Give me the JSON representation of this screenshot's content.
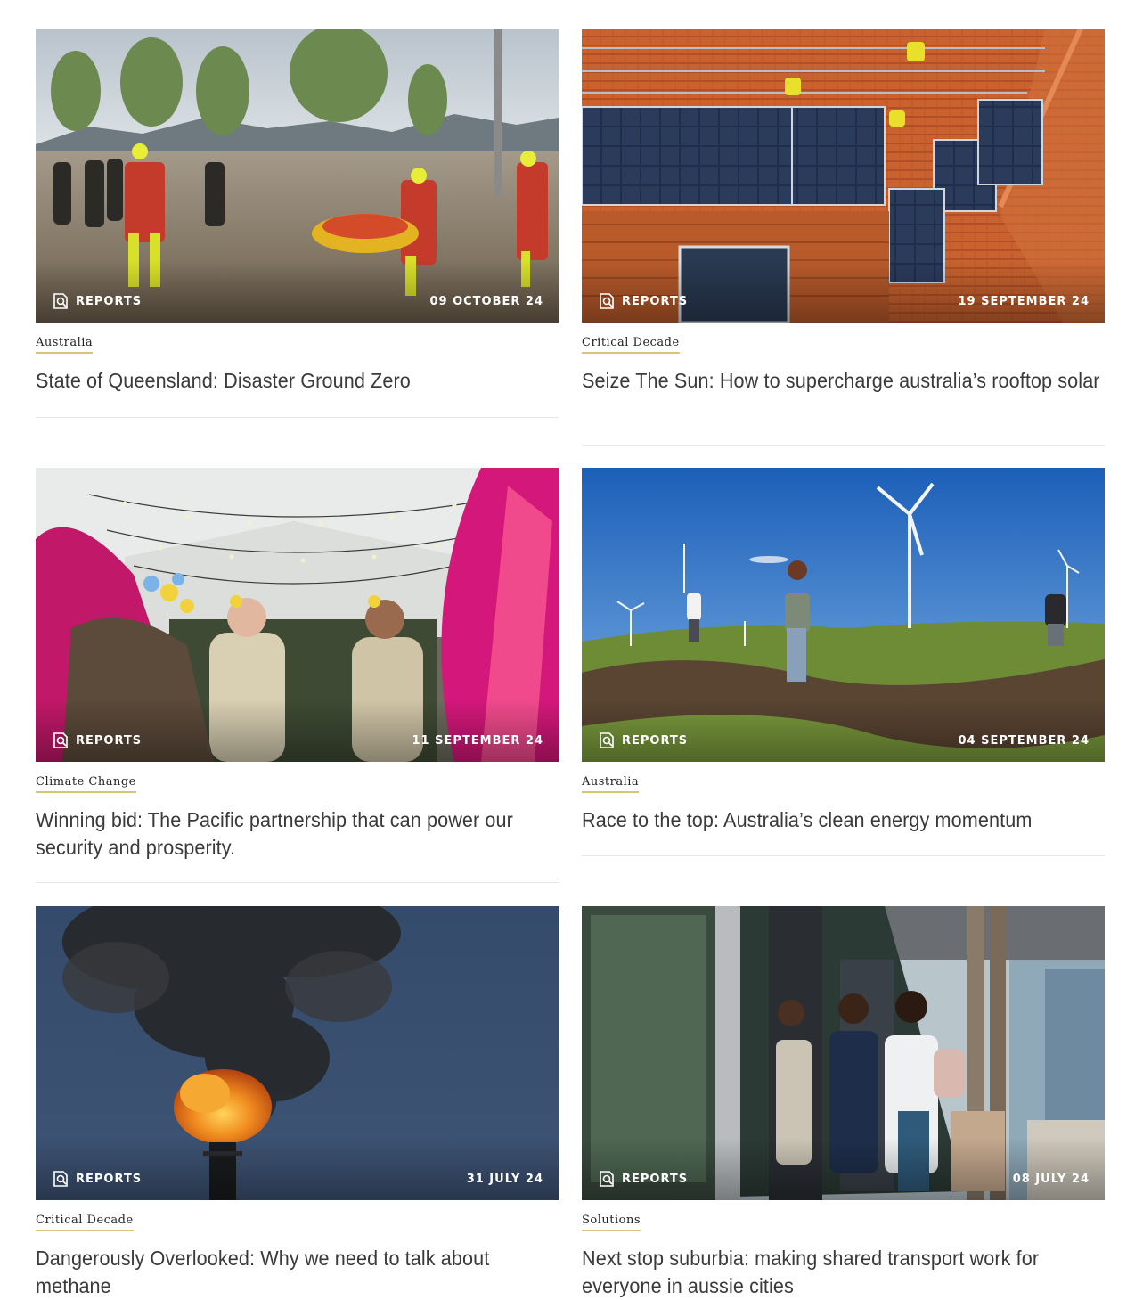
{
  "cards": [
    {
      "type_label": "REPORTS",
      "date": "09 OCTOBER 24",
      "category": "Australia",
      "title": "State of Queensland: Disaster Ground Zero"
    },
    {
      "type_label": "REPORTS",
      "date": "19 SEPTEMBER 24",
      "category": "Critical Decade",
      "title": "Seize The Sun: How to supercharge australia’s rooftop solar"
    },
    {
      "type_label": "REPORTS",
      "date": "11 SEPTEMBER 24",
      "category": "Climate Change",
      "title": "Winning bid: The Pacific partnership that can power our security and prosperity."
    },
    {
      "type_label": "REPORTS",
      "date": "04 SEPTEMBER 24",
      "category": "Australia",
      "title": "Race to the top: Australia’s clean energy momentum"
    },
    {
      "type_label": "REPORTS",
      "date": "31 JULY 24",
      "category": "Critical Decade",
      "title": "Dangerously Overlooked: Why we need to talk about methane"
    },
    {
      "type_label": "REPORTS",
      "date": "08 JULY 24",
      "category": "Solutions",
      "title": "Next stop suburbia: making shared transport work for everyone in aussie cities"
    }
  ]
}
